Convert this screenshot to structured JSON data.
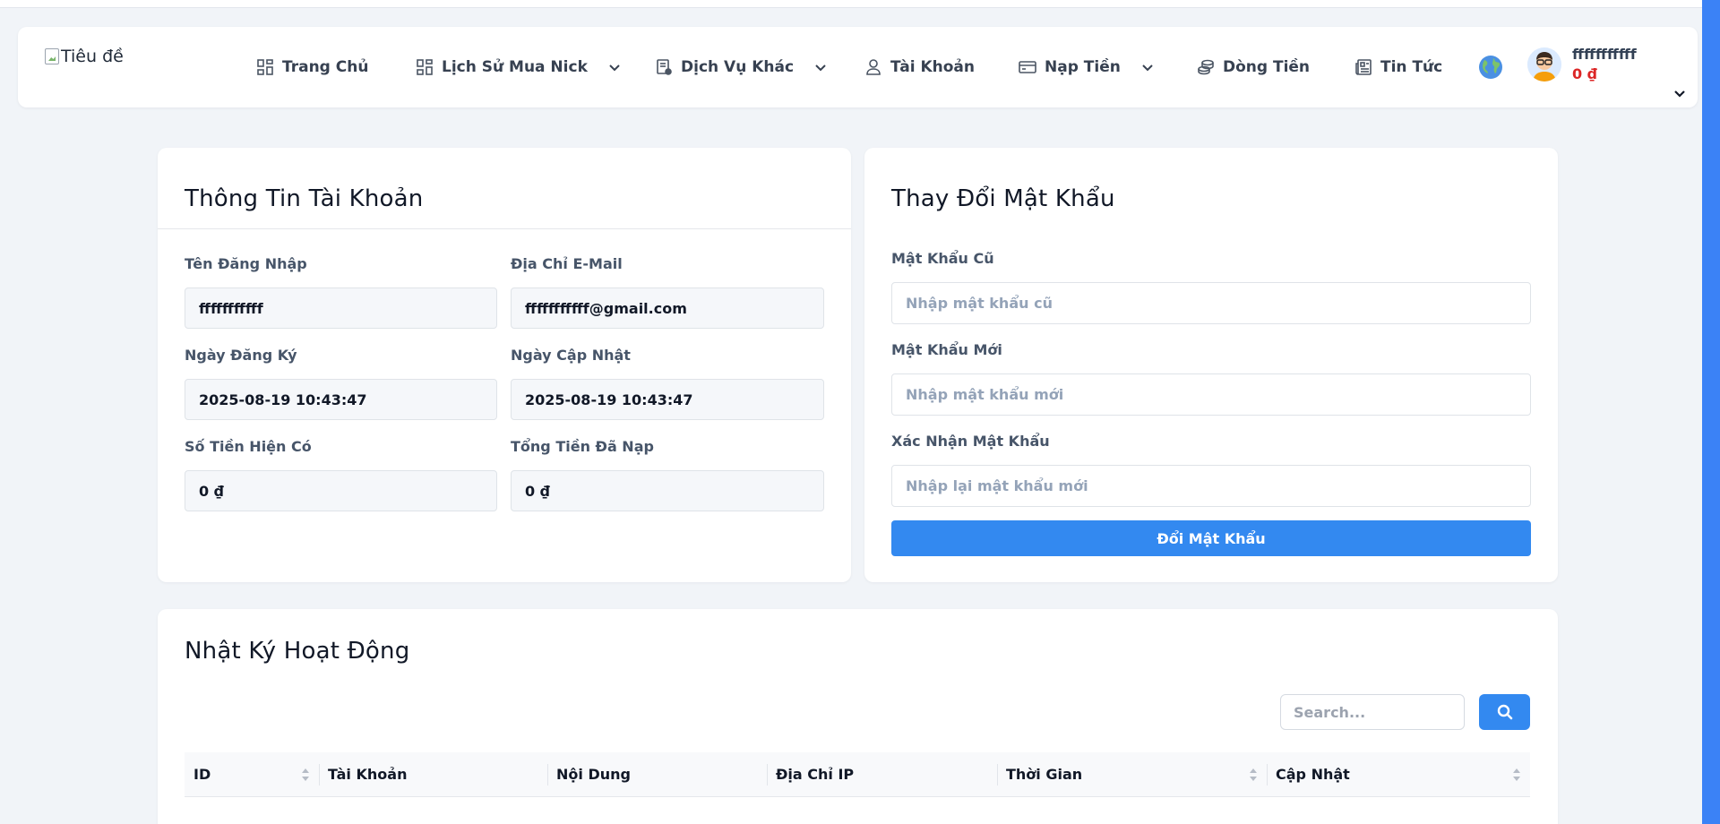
{
  "header": {
    "logo_alt": "Tiêu đề",
    "nav": [
      {
        "label": "Trang Chủ",
        "icon": "grid-icon",
        "dropdown": false
      },
      {
        "label": "Lịch Sử Mua Nick",
        "icon": "grid-icon",
        "dropdown": true
      },
      {
        "label": "Dịch Vụ Khác",
        "icon": "services-icon",
        "dropdown": true
      },
      {
        "label": "Tài Khoản",
        "icon": "user-icon",
        "dropdown": false
      },
      {
        "label": "Nạp Tiền",
        "icon": "card-icon",
        "dropdown": true
      },
      {
        "label": "Dòng Tiền",
        "icon": "coins-icon",
        "dropdown": false
      },
      {
        "label": "Tin Tức",
        "icon": "newspaper-icon",
        "dropdown": false
      }
    ],
    "language_icon": "globe-icon",
    "user": {
      "name": "fffffffffff",
      "balance": "0 ₫"
    }
  },
  "account_info": {
    "title": "Thông Tin Tài Khoản",
    "fields": {
      "username": {
        "label": "Tên Đăng Nhập",
        "value": "fffffffffff"
      },
      "email": {
        "label": "Địa Chỉ E-Mail",
        "value": "fffffffffff@gmail.com"
      },
      "created": {
        "label": "Ngày Đăng Ký",
        "value": "2025-08-19 10:43:47"
      },
      "updated": {
        "label": "Ngày Cập Nhật",
        "value": "2025-08-19 10:43:47"
      },
      "balance": {
        "label": "Số Tiền Hiện Có",
        "value": "0 ₫"
      },
      "total_deposit": {
        "label": "Tổng Tiền Đã Nạp",
        "value": "0 ₫"
      }
    }
  },
  "change_password": {
    "title": "Thay Đổi Mật Khẩu",
    "old": {
      "label": "Mật Khẩu Cũ",
      "placeholder": "Nhập mật khẩu cũ"
    },
    "new": {
      "label": "Mật Khẩu Mới",
      "placeholder": "Nhập mật khẩu mới"
    },
    "confirm": {
      "label": "Xác Nhận Mật Khẩu",
      "placeholder": "Nhập lại mật khẩu mới"
    },
    "submit_label": "Đổi Mật Khẩu"
  },
  "activity_log": {
    "title": "Nhật Ký Hoạt Động",
    "search_placeholder": "Search...",
    "columns": [
      {
        "label": "ID",
        "sortable": true
      },
      {
        "label": "Tài Khoản",
        "sortable": false
      },
      {
        "label": "Nội Dung",
        "sortable": false
      },
      {
        "label": "Địa Chỉ IP",
        "sortable": false
      },
      {
        "label": "Thời Gian",
        "sortable": true
      },
      {
        "label": "Cập Nhật",
        "sortable": true
      }
    ]
  },
  "colors": {
    "primary": "#3389f0",
    "balance_red": "#dc2626",
    "background": "#f1f4f8"
  }
}
